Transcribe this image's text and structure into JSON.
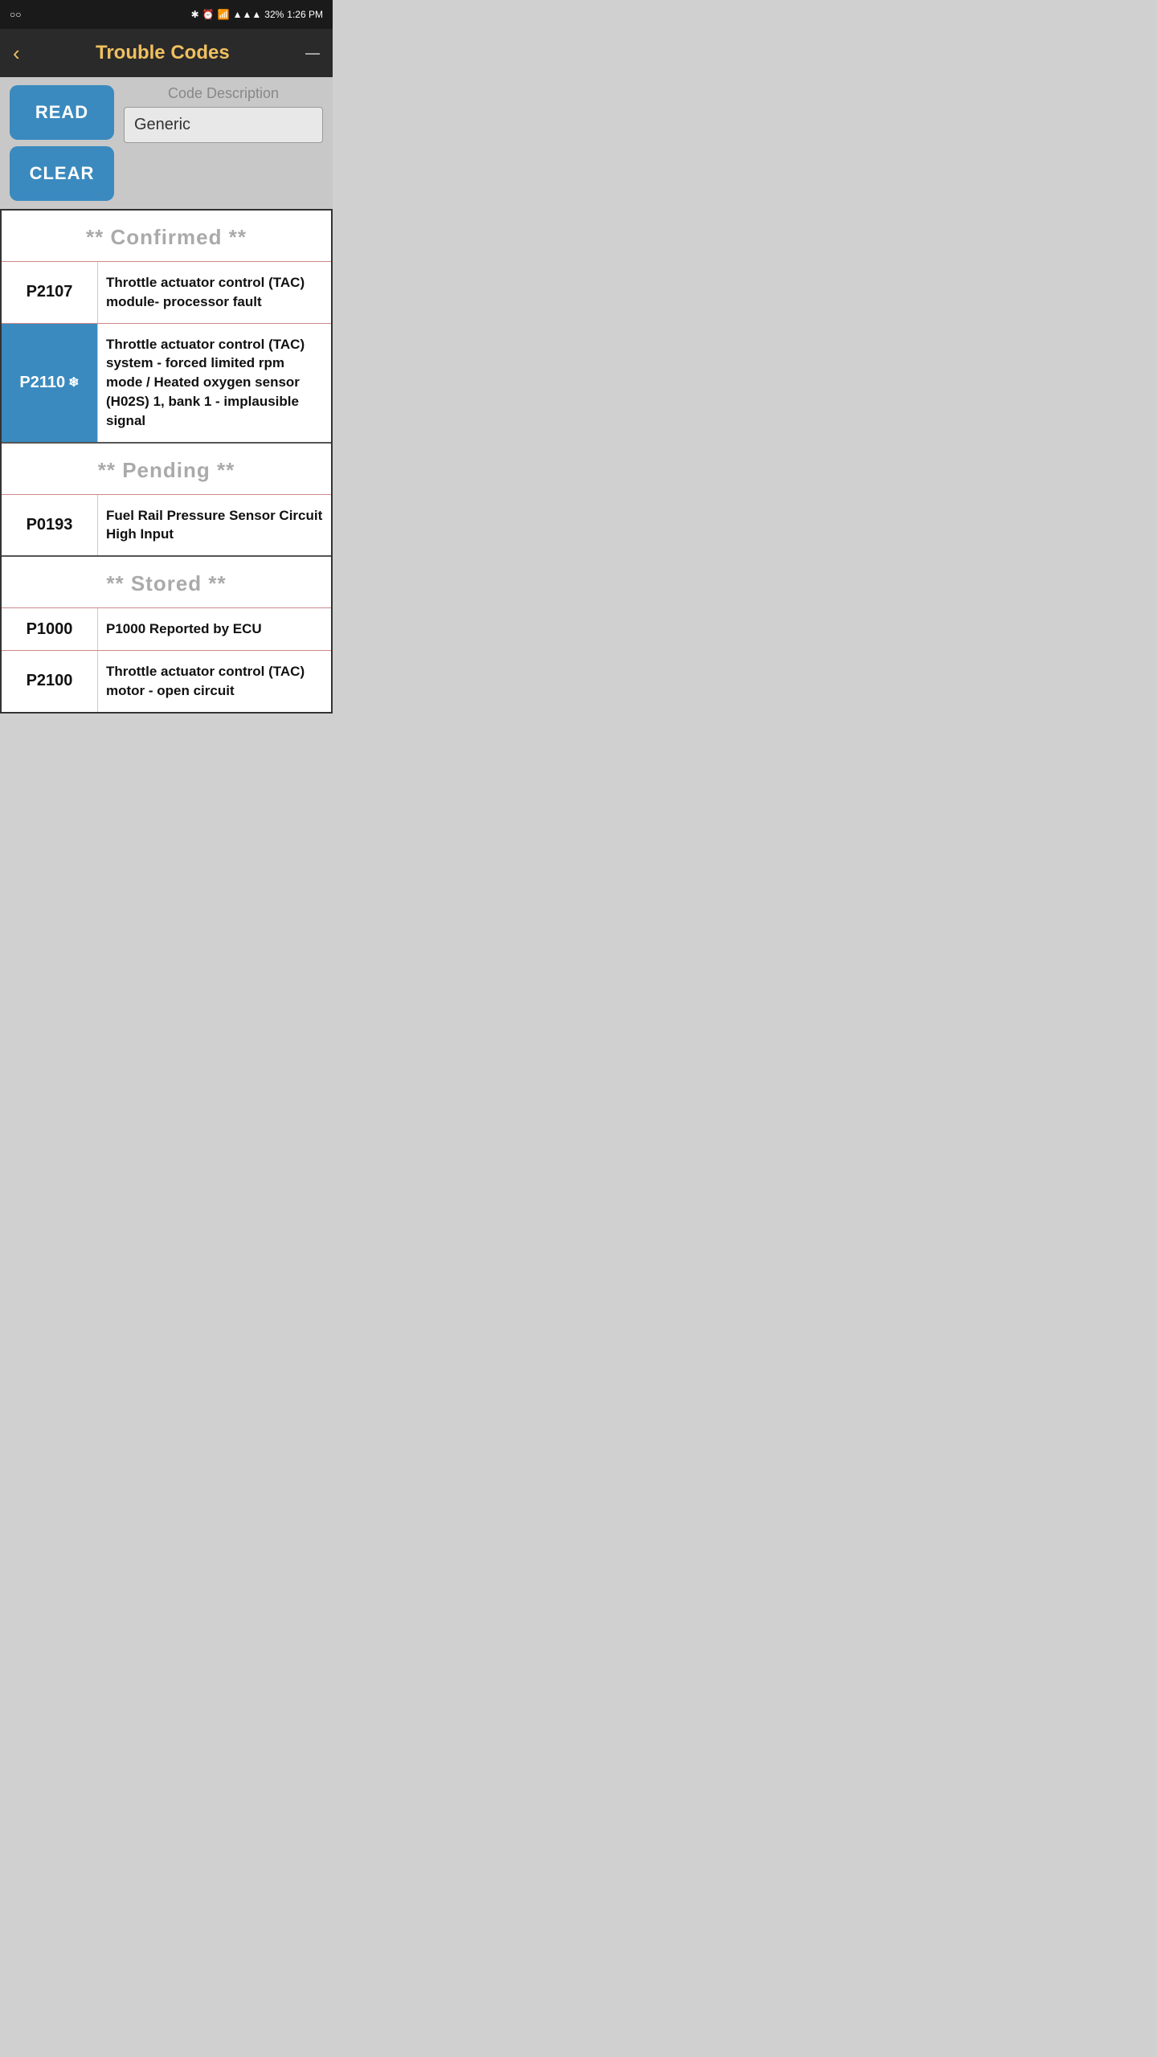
{
  "status_bar": {
    "left": "○○",
    "icons": "🔵 ⏰ 📶",
    "battery": "32%",
    "time": "1:26 PM"
  },
  "header": {
    "back_label": "‹",
    "title": "Trouble Codes",
    "menu_label": "—"
  },
  "controls": {
    "read_label": "READ",
    "clear_label": "CLEAR",
    "code_description_label": "Code Description",
    "code_description_value": "Generic"
  },
  "sections": [
    {
      "id": "confirmed",
      "header": "** Confirmed **",
      "rows": [
        {
          "code": "P2107",
          "description": "Throttle actuator control (TAC) module- processor fault",
          "highlighted": false
        },
        {
          "code": "P2110",
          "description": "Throttle actuator control (TAC) system - forced limited rpm mode / Heated oxygen sensor (H02S) 1, bank 1 - implausible signal",
          "highlighted": true,
          "icon": "❄"
        }
      ]
    },
    {
      "id": "pending",
      "header": "** Pending **",
      "rows": [
        {
          "code": "P0193",
          "description": "Fuel Rail Pressure Sensor Circuit High Input",
          "highlighted": false
        }
      ]
    },
    {
      "id": "stored",
      "header": "** Stored **",
      "rows": [
        {
          "code": "P1000",
          "description": "P1000 Reported by ECU",
          "highlighted": false
        },
        {
          "code": "P2100",
          "description": "Throttle actuator control (TAC) motor - open circuit",
          "highlighted": false
        }
      ]
    }
  ]
}
